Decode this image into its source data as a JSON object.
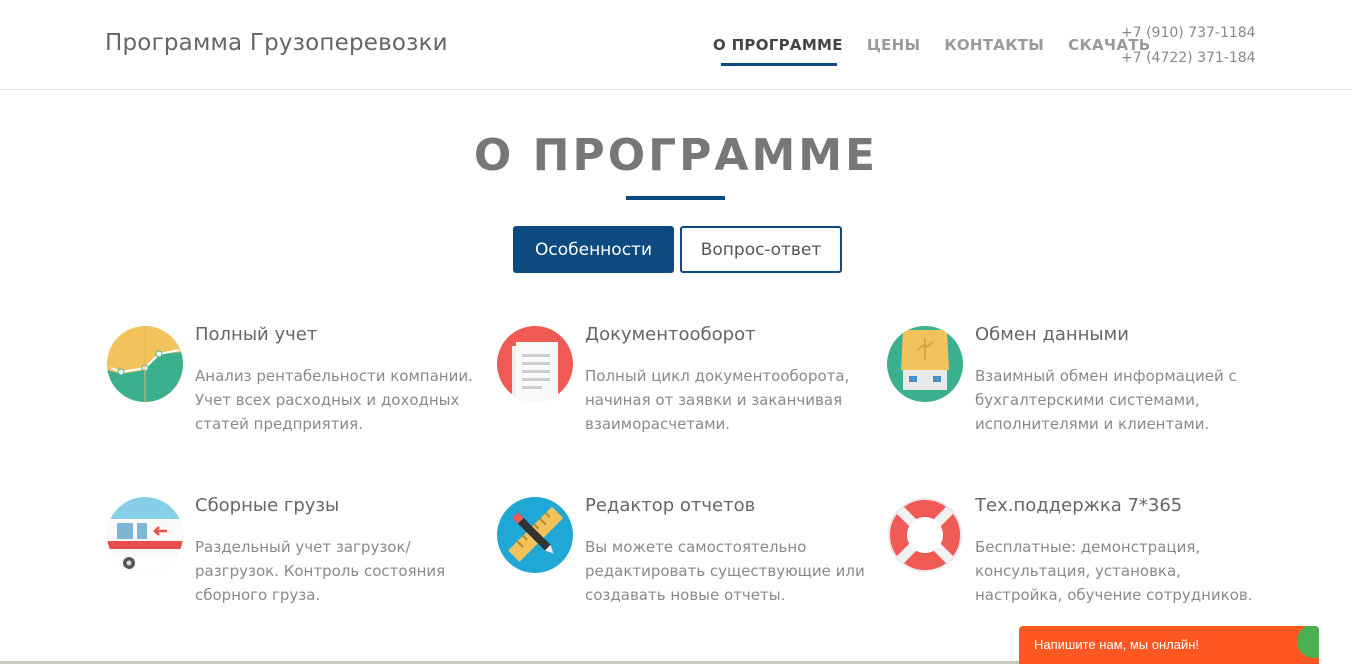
{
  "brand": "Программа Грузоперевозки",
  "nav": [
    {
      "label": "О ПРОГРАММЕ",
      "active": true
    },
    {
      "label": "ЦЕНЫ",
      "active": false
    },
    {
      "label": "КОНТАКТЫ",
      "active": false
    },
    {
      "label": "СКАЧАТЬ",
      "active": false
    }
  ],
  "phones": [
    "+7 (910) 737-1184",
    "+7 (4722) 371-184"
  ],
  "section": {
    "title": "О ПРОГРАММЕ"
  },
  "tabs": [
    {
      "label": "Особенности",
      "active": true
    },
    {
      "label": "Вопрос-ответ",
      "active": false
    }
  ],
  "features": [
    {
      "title": "Полный учет",
      "desc": "Анализ рентабельности компании. Учет всех расходных и доходных статей предприятия.",
      "icon": "chart-icon"
    },
    {
      "title": "Документооборот",
      "desc": "Полный цикл документооборота, начиная от заявки и заканчивая взаиморасчетами.",
      "icon": "document-icon"
    },
    {
      "title": "Обмен данными",
      "desc": "Взаимный обмен информацией с бухгалтерскими системами, исполнителями и клиентами.",
      "icon": "usb-icon"
    },
    {
      "title": "Сборные грузы",
      "desc": "Раздельный учет загрузок/ разгрузок. Контроль состояния сборного груза.",
      "icon": "truck-icon"
    },
    {
      "title": "Редактор отчетов",
      "desc": "Вы можете самостоятельно редактировать существующие или создавать новые отчеты.",
      "icon": "ruler-pencil-icon"
    },
    {
      "title": "Тех.поддержка 7*365",
      "desc": "Бесплатные: демонстрация, консультация, установка, настройка, обучение сотрудников.",
      "icon": "lifebuoy-icon"
    }
  ],
  "chat": {
    "label": "Напишите нам, мы онлайн!"
  },
  "colors": {
    "accent": "#0d4a80",
    "chat": "#ff5722"
  }
}
